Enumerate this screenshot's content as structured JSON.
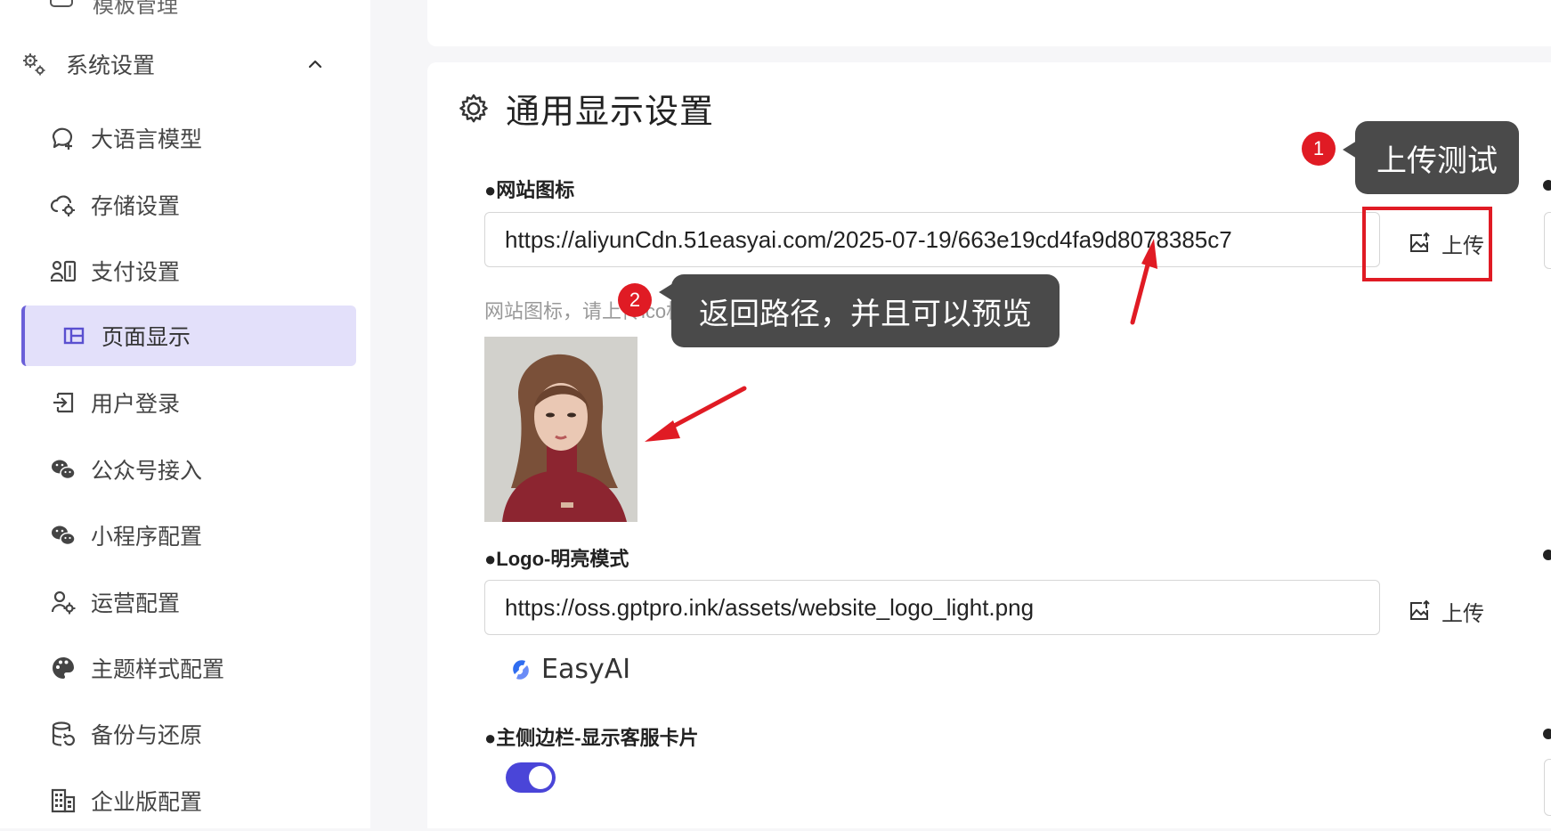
{
  "sidebar": {
    "top_cut_label": "模板管理",
    "group": {
      "label": "系统设置",
      "expanded": true
    },
    "items": [
      {
        "label": "大语言模型",
        "icon": "chat-plus-icon"
      },
      {
        "label": "存储设置",
        "icon": "cloud-gear-icon"
      },
      {
        "label": "支付设置",
        "icon": "payment-icon"
      },
      {
        "label": "页面显示",
        "icon": "layout-icon",
        "active": true
      },
      {
        "label": "用户登录",
        "icon": "login-icon"
      },
      {
        "label": "公众号接入",
        "icon": "wechat-icon"
      },
      {
        "label": "小程序配置",
        "icon": "wechat-icon"
      },
      {
        "label": "运营配置",
        "icon": "user-gear-icon"
      },
      {
        "label": "主题样式配置",
        "icon": "palette-icon"
      },
      {
        "label": "备份与还原",
        "icon": "database-restore-icon"
      },
      {
        "label": "企业版配置",
        "icon": "building-icon"
      }
    ]
  },
  "main": {
    "section_title": "通用显示设置",
    "favicon": {
      "label": "网站图标",
      "value": "https://aliyunCdn.51easyai.com/2025-07-19/663e19cd4fa9d8078385c7",
      "help": "网站图标，请上传ico格式图标",
      "upload_label": "上传"
    },
    "logo_light": {
      "label": "Logo-明亮模式",
      "value": "https://oss.gptpro.ink/assets/website_logo_light.png",
      "upload_label": "上传",
      "preview_text": "EasyAI"
    },
    "sidebar_card": {
      "label": "主侧边栏-显示客服卡片",
      "enabled": true
    }
  },
  "annotations": {
    "badge1": "1",
    "callout1": "上传测试",
    "badge2": "2",
    "callout2": "返回路径，并且可以预览"
  },
  "colors": {
    "accent": "#4a45d8",
    "active_bg": "#e3e0fa",
    "annotation_red": "#e01b24",
    "callout_bg": "#4a4a4a"
  }
}
